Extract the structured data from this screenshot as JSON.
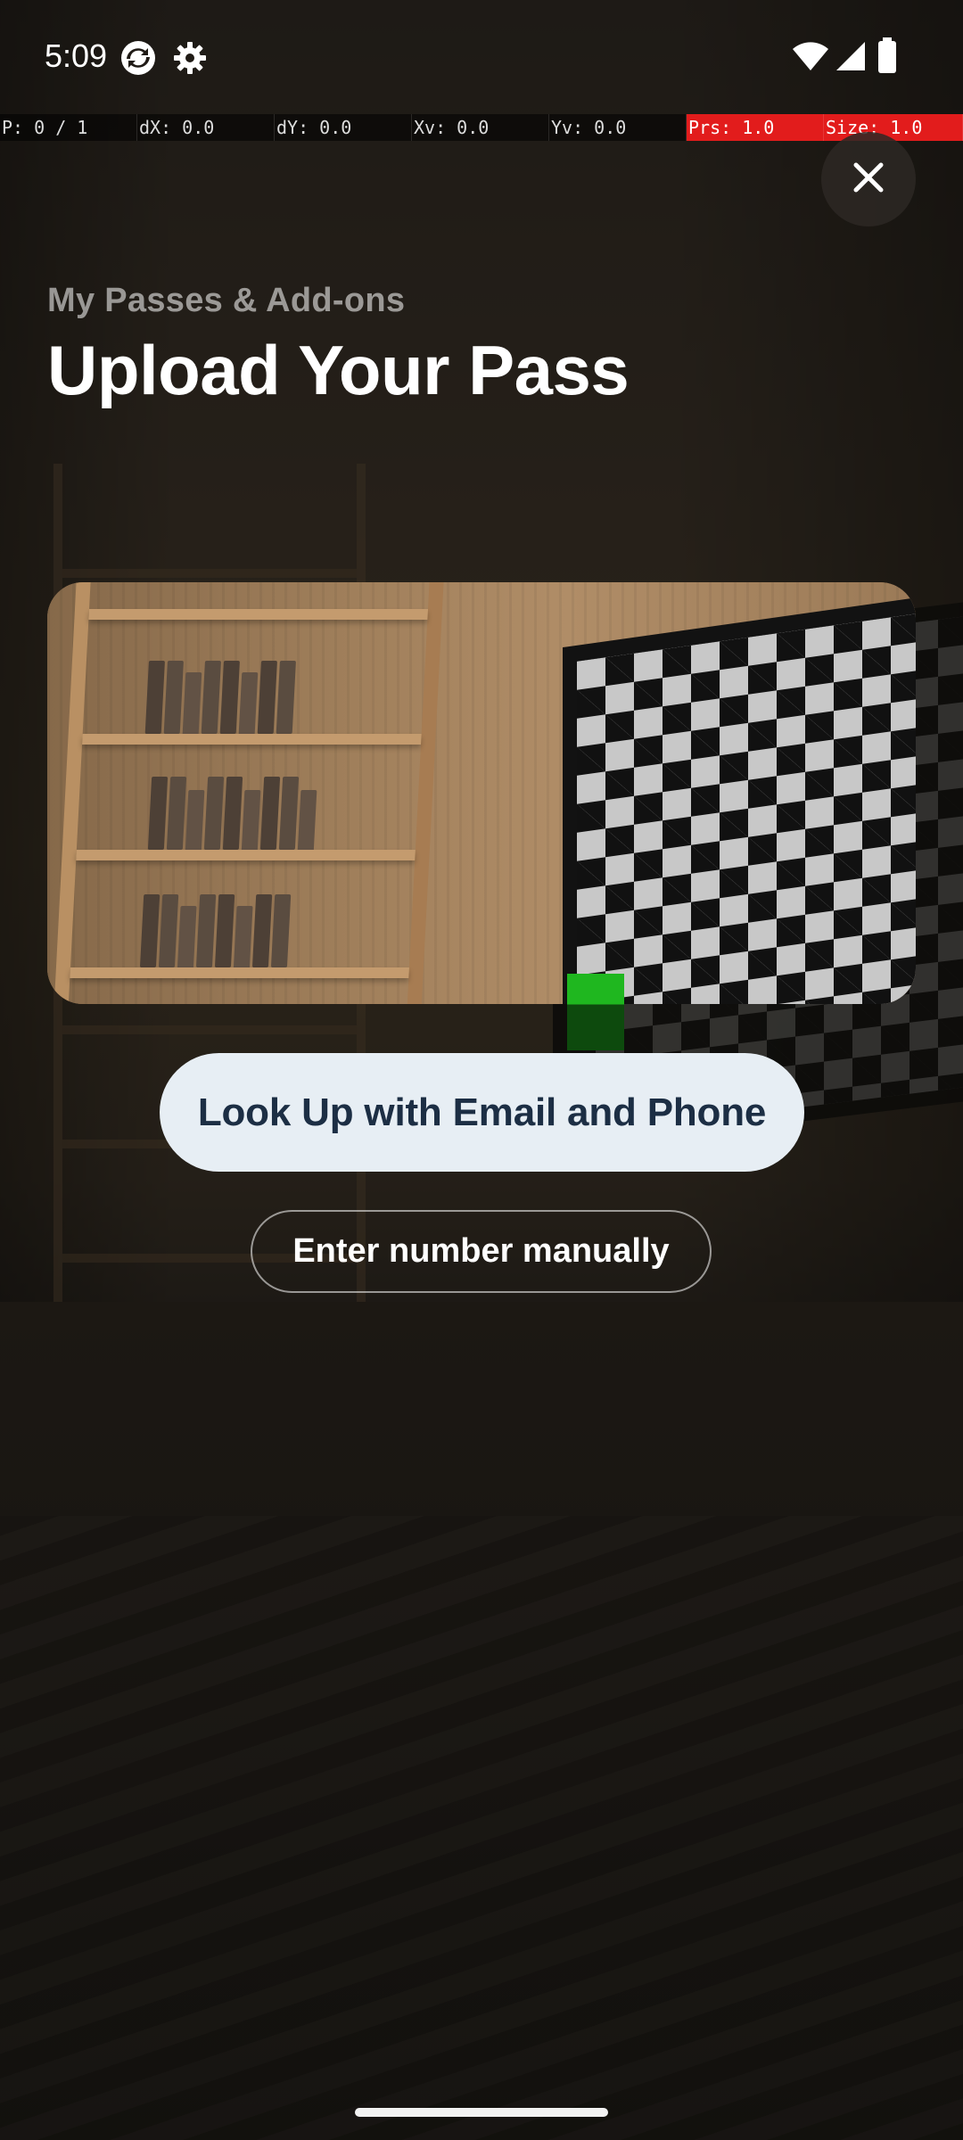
{
  "status_bar": {
    "time": "5:09",
    "icons_left": [
      "sync-app-icon",
      "settings-gear-icon"
    ],
    "icons_right": [
      "wifi-icon",
      "cellular-signal-icon",
      "battery-icon"
    ]
  },
  "debug_overlay": {
    "cells": [
      "P: 0 / 1",
      "dX: 0.0",
      "dY: 0.0",
      "Xv: 0.0",
      "Yv: 0.0",
      "Prs: 1.0",
      "Size: 1.0"
    ],
    "alert_color": "#e21c1c"
  },
  "close_button": {
    "icon": "close-icon"
  },
  "header": {
    "subtitle": "My Passes & Add-ons",
    "title": "Upload Your Pass"
  },
  "actions": {
    "primary_label": "Look Up with Email and Phone",
    "secondary_label": "Enter number manually"
  },
  "colors": {
    "primary_button_bg": "#e7eef4",
    "primary_button_text": "#1c2e44",
    "title_text": "#ffffff"
  }
}
